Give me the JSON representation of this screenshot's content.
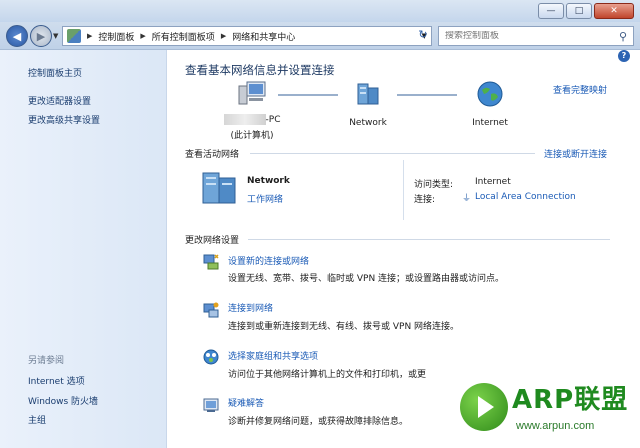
{
  "window": {
    "min_label": "—",
    "max_label": "□",
    "close_label": "✕"
  },
  "address": {
    "crumbs": [
      "控制面板",
      "所有控制面板项",
      "网络和共享中心"
    ],
    "search_placeholder": "搜索控制面板"
  },
  "sidebar": {
    "home": "控制面板主页",
    "adapter": "更改适配器设置",
    "advanced": "更改高级共享设置",
    "see_also": "另请参阅",
    "internet_options": "Internet 选项",
    "firewall": "Windows 防火墙",
    "homegroup": "主组"
  },
  "main": {
    "title": "查看基本网络信息并设置连接",
    "full_map": "查看完整映射",
    "nodes": {
      "pc_name": "-PC",
      "pc_sub": "(此计算机)",
      "network": "Network",
      "internet": "Internet"
    },
    "active_title": "查看活动网络",
    "connect_link": "连接或断开连接",
    "active": {
      "name": "Network",
      "type": "工作网络",
      "access_label": "访问类型:",
      "access_value": "Internet",
      "conn_label": "连接:",
      "conn_value": "Local Area Connection"
    },
    "change_title": "更改网络设置",
    "tasks": [
      {
        "title": "设置新的连接或网络",
        "desc": "设置无线、宽带、拨号、临时或 VPN 连接；或设置路由器或访问点。"
      },
      {
        "title": "连接到网络",
        "desc": "连接到或重新连接到无线、有线、拨号或 VPN 网络连接。"
      },
      {
        "title": "选择家庭组和共享选项",
        "desc": "访问位于其他网络计算机上的文件和打印机，或更"
      },
      {
        "title": "疑难解答",
        "desc": "诊断并修复网络问题，或获得故障排除信息。"
      }
    ]
  },
  "watermark": {
    "title": "ARP联盟",
    "url": "www.arpun.com"
  }
}
